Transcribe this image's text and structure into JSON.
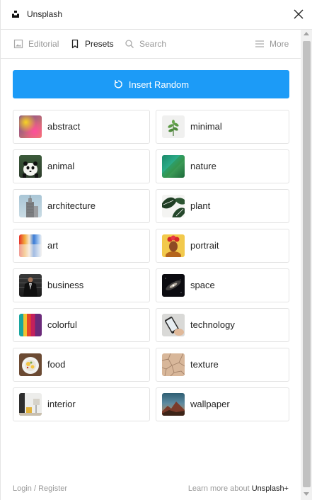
{
  "window": {
    "title": "Unsplash"
  },
  "tabs": [
    {
      "label": "Editorial",
      "active": false
    },
    {
      "label": "Presets",
      "active": true
    },
    {
      "label": "Search",
      "active": false
    },
    {
      "label": "More",
      "active": false
    }
  ],
  "insert_button": {
    "label": "Insert Random"
  },
  "presets": [
    {
      "label": "abstract"
    },
    {
      "label": "minimal"
    },
    {
      "label": "animal"
    },
    {
      "label": "nature"
    },
    {
      "label": "architecture"
    },
    {
      "label": "plant"
    },
    {
      "label": "art"
    },
    {
      "label": "portrait"
    },
    {
      "label": "business"
    },
    {
      "label": "space"
    },
    {
      "label": "colorful"
    },
    {
      "label": "technology"
    },
    {
      "label": "food"
    },
    {
      "label": "texture"
    },
    {
      "label": "interior"
    },
    {
      "label": "wallpaper"
    }
  ],
  "footer": {
    "login": "Login / Register",
    "learn_more": "Learn more about ",
    "brand": "Unsplash+"
  },
  "colors": {
    "accent": "#1c9bf7",
    "border": "#e3e3e3",
    "muted": "#999999"
  }
}
